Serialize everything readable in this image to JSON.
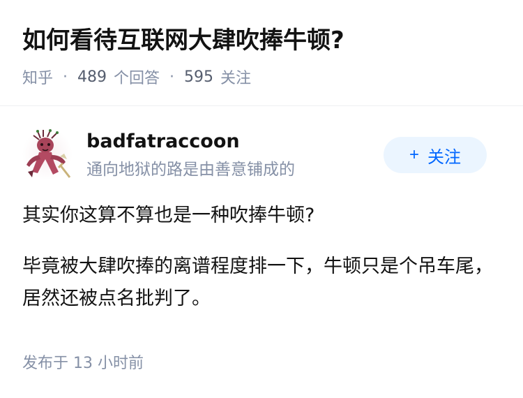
{
  "question": {
    "title": "如何看待互联网大肆吹捧牛顿?",
    "source": "知乎",
    "separator": "·",
    "answer_count": "489",
    "answer_label": "个回答",
    "follower_count": "595",
    "follower_label": "关注"
  },
  "author": {
    "name": "badfatraccoon",
    "bio": "通向地狱的路是由善意铺成的",
    "follow_plus": "+",
    "follow_label": "关注"
  },
  "answer": {
    "paragraphs": [
      "其实你这算不算也是一种吹捧牛顿?",
      "毕竟被大肆吹捧的离谱程度排一下，牛顿只是个吊车尾，居然还被点名批判了。"
    ],
    "publish_label": "发布于",
    "publish_time": "13 小时前"
  },
  "colors": {
    "accent": "#0066ff",
    "follow_bg": "#ebf5ff",
    "meta_gray": "#8590a6",
    "text": "#121212"
  },
  "icons": {
    "avatar": "groot-avatar-icon"
  }
}
